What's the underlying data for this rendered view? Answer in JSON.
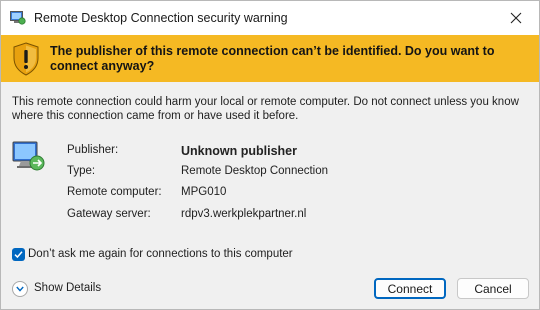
{
  "window": {
    "title": "Remote Desktop Connection security warning"
  },
  "banner": {
    "text": "The publisher of this remote connection can’t be identified. Do you want to connect anyway?"
  },
  "description": "This remote connection could harm your local or remote computer. Do not connect unless you know where this connection came from or have used it before.",
  "details": [
    {
      "label": "Publisher:",
      "value": "Unknown publisher"
    },
    {
      "label": "Type:",
      "value": "Remote Desktop Connection"
    },
    {
      "label": "Remote computer:",
      "value": "MPG010"
    },
    {
      "label": "Gateway server:",
      "value": "rdpv3.werkplekpartner.nl"
    }
  ],
  "checkbox": {
    "label": "Don’t ask me again for connections to this computer",
    "checked": true
  },
  "show_details": {
    "label": "Show Details"
  },
  "buttons": {
    "connect": "Connect",
    "cancel": "Cancel"
  },
  "colors": {
    "banner": "#f5b923",
    "accent": "#0067c0"
  }
}
